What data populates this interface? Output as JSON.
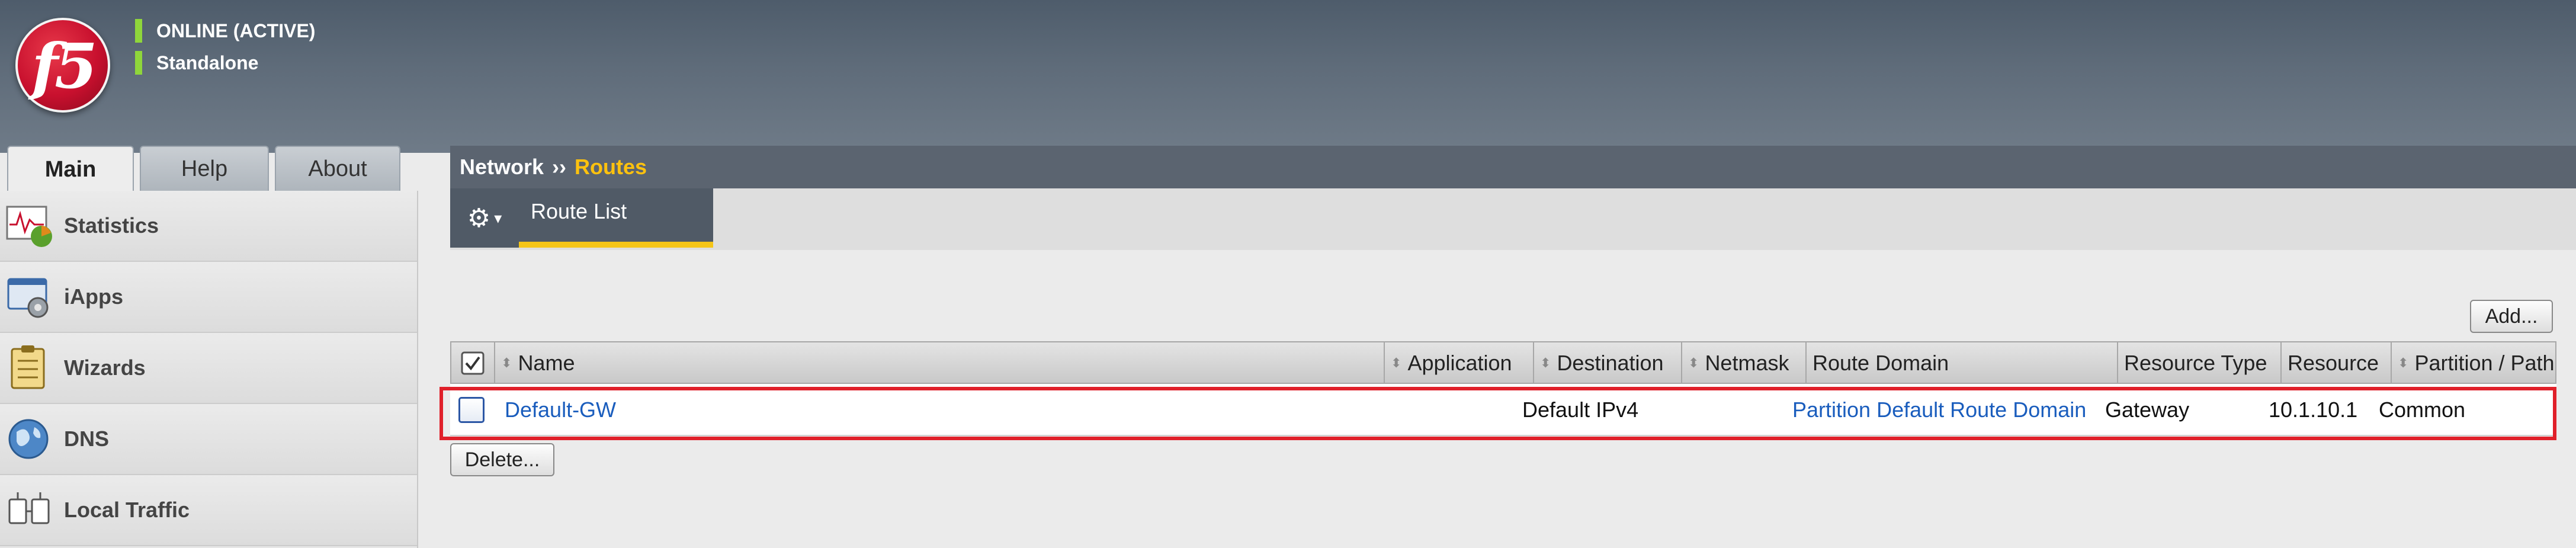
{
  "status": {
    "line1": "ONLINE (ACTIVE)",
    "line2": "Standalone",
    "indicator_color": "#8fd63b"
  },
  "logo": {
    "text": "f5"
  },
  "tabs": [
    {
      "label": "Main",
      "active": true
    },
    {
      "label": "Help",
      "active": false
    },
    {
      "label": "About",
      "active": false
    }
  ],
  "sidebar": {
    "items": [
      {
        "label": "Statistics",
        "icon": "statistics-icon"
      },
      {
        "label": "iApps",
        "icon": "iapps-icon"
      },
      {
        "label": "Wizards",
        "icon": "wizards-icon"
      },
      {
        "label": "DNS",
        "icon": "dns-globe-icon"
      },
      {
        "label": "Local Traffic",
        "icon": "local-traffic-icon"
      }
    ]
  },
  "breadcrumb": {
    "parent": "Network",
    "separator": "››",
    "current": "Routes",
    "current_color": "#ffc20e"
  },
  "subnav": {
    "gear_icon": "gear-icon",
    "menu_indicator": "▾",
    "tab_label": "Route List"
  },
  "actions": {
    "add": "Add...",
    "delete": "Delete..."
  },
  "table": {
    "columns": [
      "Name",
      "Application",
      "Destination",
      "Netmask",
      "Route Domain",
      "Resource Type",
      "Resource",
      "Partition / Path"
    ],
    "rows": [
      {
        "name": "Default-GW",
        "application": "",
        "destination": "Default IPv4",
        "netmask": "",
        "route_domain": "Partition Default Route Domain",
        "resource_type": "Gateway",
        "resource": "10.1.10.1",
        "partition": "Common"
      }
    ]
  },
  "colors": {
    "highlight": "#e0202a",
    "link": "#1a5dbd",
    "accent": "#f5c518"
  }
}
